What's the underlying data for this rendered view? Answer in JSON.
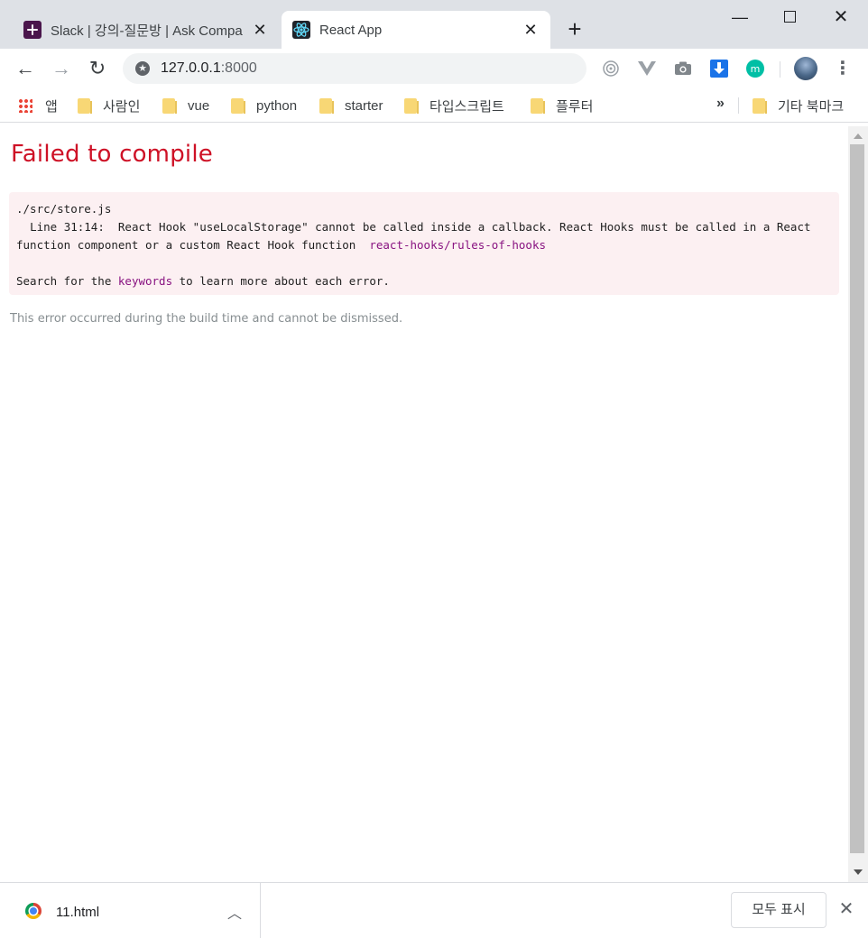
{
  "tabs": [
    {
      "title": "Slack | 강의-질문방 | Ask Compa",
      "favicon": "slack-icon",
      "close": "✕"
    },
    {
      "title": "React App",
      "favicon": "react-icon",
      "close": "✕",
      "active": true
    }
  ],
  "new_tab_label": "+",
  "address": {
    "host": "127.0.0.1",
    "port": ":8000"
  },
  "bookmarks": {
    "apps_label": "앱",
    "folders": [
      "사람인",
      "vue",
      "python",
      "starter",
      "타입스크립트",
      "플루터"
    ],
    "overflow_label": "»",
    "other_label": "기타 북마크"
  },
  "error_page": {
    "title": "Failed to compile",
    "file": "./src/store.js",
    "message_line1": "  Line 31:14:  React Hook \"useLocalStorage\" cannot be called inside a callback. React Hooks must be called in a React",
    "message_line2": "function component or a custom React Hook function  ",
    "rule_link": "react-hooks/rules-of-hooks",
    "search_prefix": "Search for the ",
    "search_link": "keywords",
    "search_suffix": " to learn more about each error.",
    "footer": "This error occurred during the build time and cannot be dismissed."
  },
  "download_shelf": {
    "file_name": "11.html",
    "show_all_label": "모두 표시"
  },
  "colors": {
    "error_title": "#ce1126",
    "error_box_bg": "#fcf0f2",
    "link_purple": "#881280",
    "tabstrip": "#dee1e6"
  }
}
